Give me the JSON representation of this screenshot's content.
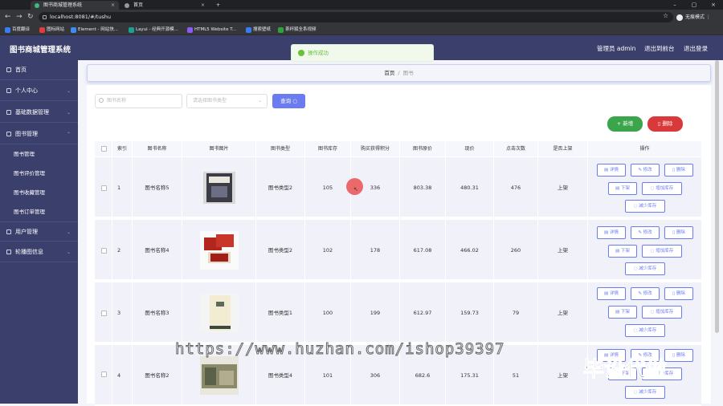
{
  "browser": {
    "tabs": [
      {
        "title": "图书商城管理系统",
        "icon_color": "#41b883"
      },
      {
        "title": "首页",
        "icon_color": "#999999"
      }
    ],
    "address": "localhost:8081/#/tushu",
    "profile": "无痕模式",
    "bookmarks": [
      {
        "label": "百度翻译",
        "icon_color": "#3b7cf5"
      },
      {
        "label": "图标网站",
        "icon_color": "#e23c3c"
      },
      {
        "label": "Element - 网站快...",
        "icon_color": "#3c8ef5"
      },
      {
        "label": "Layui - 经典开源模...",
        "icon_color": "#1aa094"
      },
      {
        "label": "HTML5 Website T...",
        "icon_color": "#8a5cf5"
      },
      {
        "label": "搜索壁纸",
        "icon_color": "#3b7cf5"
      },
      {
        "label": "茶杯狐全系视频",
        "icon_color": "#2aa53a"
      }
    ]
  },
  "header": {
    "title": "图书商城管理系统",
    "admin_label": "管理员 admin",
    "backend_link": "退出到前台",
    "logout_link": "退出登录"
  },
  "toast": {
    "message": "操作成功",
    "color": "#67c23a"
  },
  "sidebar": {
    "items": [
      {
        "label": "首页"
      },
      {
        "label": "个人中心"
      },
      {
        "label": "基础数据管理"
      },
      {
        "label": "图书管理"
      },
      {
        "label": "用户管理"
      },
      {
        "label": "轮播图信息"
      }
    ],
    "sub_items": [
      {
        "label": "图书管理"
      },
      {
        "label": "图书评价管理"
      },
      {
        "label": "图书收藏管理"
      },
      {
        "label": "图书订单管理"
      }
    ]
  },
  "breadcrumb": {
    "home": "首页",
    "separator": "/",
    "current": "图书"
  },
  "search": {
    "name_placeholder": "图书名称",
    "type_placeholder": "请选择图书类型",
    "button": "查询"
  },
  "actions": {
    "add": "新增",
    "delete": "删除",
    "add_color": "#3aa54a",
    "delete_color": "#d9393a"
  },
  "table": {
    "headers": [
      "索引",
      "图书名称",
      "图书图片",
      "图书类型",
      "图书库存",
      "购买获得积分",
      "图书原价",
      "现价",
      "点击次数",
      "是否上架",
      "操作"
    ],
    "op_labels": {
      "detail": "详情",
      "edit": "修改",
      "delete": "删除",
      "down": "下架",
      "add_stock": "增加库存",
      "reduce_stock": "减少库存"
    },
    "rows": [
      {
        "index": "1",
        "name": "图书名称5",
        "type": "图书类型2",
        "stock": "105",
        "points": "336",
        "orig": "803.38",
        "price": "480.31",
        "clicks": "476",
        "status": "上架"
      },
      {
        "index": "2",
        "name": "图书名称4",
        "type": "图书类型2",
        "stock": "102",
        "points": "178",
        "orig": "617.08",
        "price": "466.02",
        "clicks": "260",
        "status": "上架"
      },
      {
        "index": "3",
        "name": "图书名称3",
        "type": "图书类型1",
        "stock": "100",
        "points": "199",
        "orig": "612.97",
        "price": "159.73",
        "clicks": "79",
        "status": "上架"
      },
      {
        "index": "4",
        "name": "图书名称2",
        "type": "图书类型4",
        "stock": "101",
        "points": "306",
        "orig": "682.6",
        "price": "175.31",
        "clicks": "51",
        "status": "上架"
      }
    ]
  },
  "watermark": {
    "url": "https://www.huzhan.com/ishop39397",
    "slogan": "毕设代做"
  }
}
